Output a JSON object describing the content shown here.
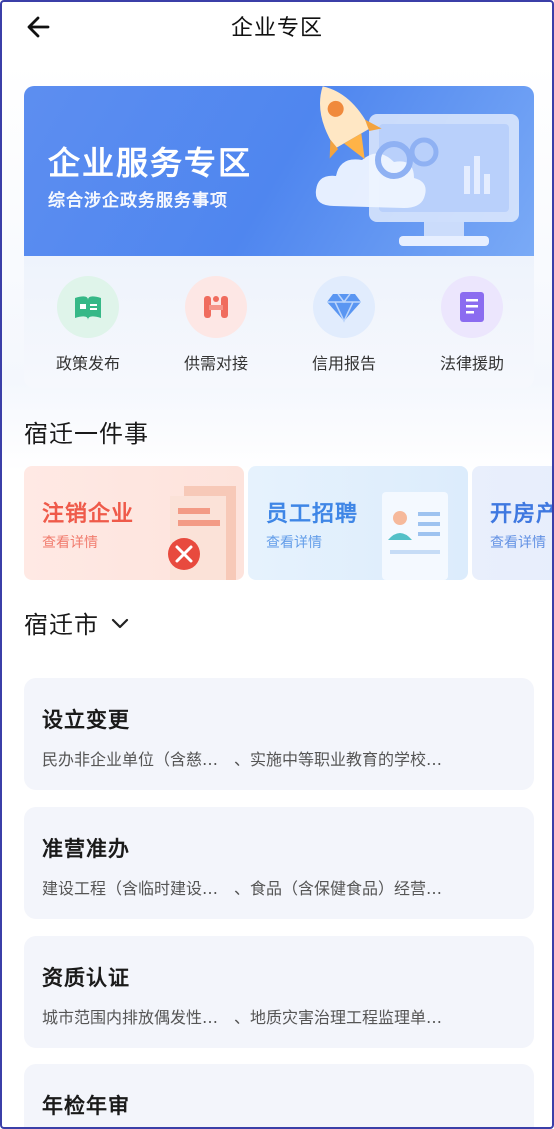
{
  "header": {
    "title": "企业专区",
    "back_icon": "arrow-left-icon"
  },
  "banner": {
    "title": "企业服务专区",
    "subtitle": "综合涉企政务服务事项",
    "colors": {
      "start": "#5d8ef0",
      "end": "#7aaaf6"
    }
  },
  "services": [
    {
      "label": "政策发布",
      "icon": "policy-book-icon",
      "color": "#3fbf8e"
    },
    {
      "label": "供需对接",
      "icon": "handshake-icon",
      "color": "#f0746a"
    },
    {
      "label": "信用报告",
      "icon": "diamond-icon",
      "color": "#4d8ff0"
    },
    {
      "label": "法律援助",
      "icon": "legal-document-icon",
      "color": "#8b6cf0"
    }
  ],
  "events_section": {
    "title": "宿迁一件事"
  },
  "events": [
    {
      "title": "注销企业",
      "sub": "查看详情",
      "icon": "cancel-document-icon"
    },
    {
      "title": "员工招聘",
      "sub": "查看详情",
      "icon": "resume-icon"
    },
    {
      "title": "开房产",
      "sub": "查看详情",
      "icon": "house-icon"
    }
  ],
  "region": {
    "label": "宿迁市",
    "icon": "chevron-down-icon"
  },
  "categories": [
    {
      "title": "设立变更",
      "desc": "民办非企业单位（含慈…　、实施中等职业教育的学校…"
    },
    {
      "title": "准营准办",
      "desc": "建设工程（含临时建设…　、食品（含保健食品）经营…"
    },
    {
      "title": "资质认证",
      "desc": "城市范围内排放偶发性…　、地质灾害治理工程监理单…"
    },
    {
      "title": "年检年审",
      "desc": ""
    }
  ]
}
